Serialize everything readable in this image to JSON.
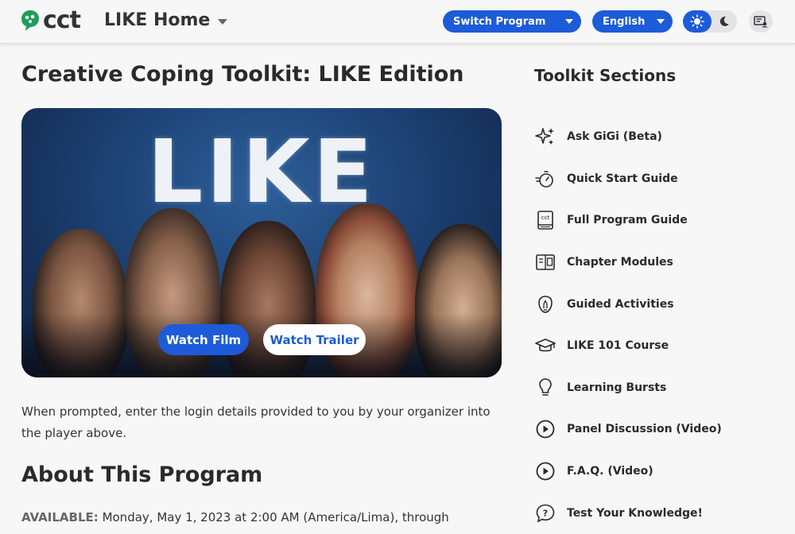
{
  "header": {
    "logo_text": "cct",
    "home_title": "LIKE Home",
    "switch_program_label": "Switch Program",
    "language_label": "English",
    "accent_color": "#1d5bd8"
  },
  "main": {
    "title": "Creative Coping Toolkit: LIKE Edition",
    "hero_word": "LIKE",
    "watch_film_label": "Watch Film",
    "watch_trailer_label": "Watch Trailer",
    "login_note": "When prompted, enter the login details provided to you by your organizer into the player above.",
    "about_title": "About This Program",
    "available_label": "AVAILABLE:",
    "available_text": "Monday, May 1, 2023 at 2:00 AM (America/Lima), through"
  },
  "sidebar": {
    "title": "Toolkit Sections",
    "items": [
      {
        "label": "Ask GiGi (Beta)",
        "icon": "sparkles-icon"
      },
      {
        "label": "Quick Start Guide",
        "icon": "stopwatch-icon"
      },
      {
        "label": "Full Program Guide",
        "icon": "book-icon"
      },
      {
        "label": "Chapter Modules",
        "icon": "modules-icon"
      },
      {
        "label": "Guided Activities",
        "icon": "lightbulb-hand-icon"
      },
      {
        "label": "LIKE 101 Course",
        "icon": "graduation-cap-icon"
      },
      {
        "label": "Learning Bursts",
        "icon": "lightbulb-icon"
      },
      {
        "label": "Panel Discussion (Video)",
        "icon": "play-circle-icon"
      },
      {
        "label": "F.A.Q. (Video)",
        "icon": "play-circle-icon"
      },
      {
        "label": "Test Your Knowledge!",
        "icon": "question-bubble-icon"
      }
    ]
  }
}
